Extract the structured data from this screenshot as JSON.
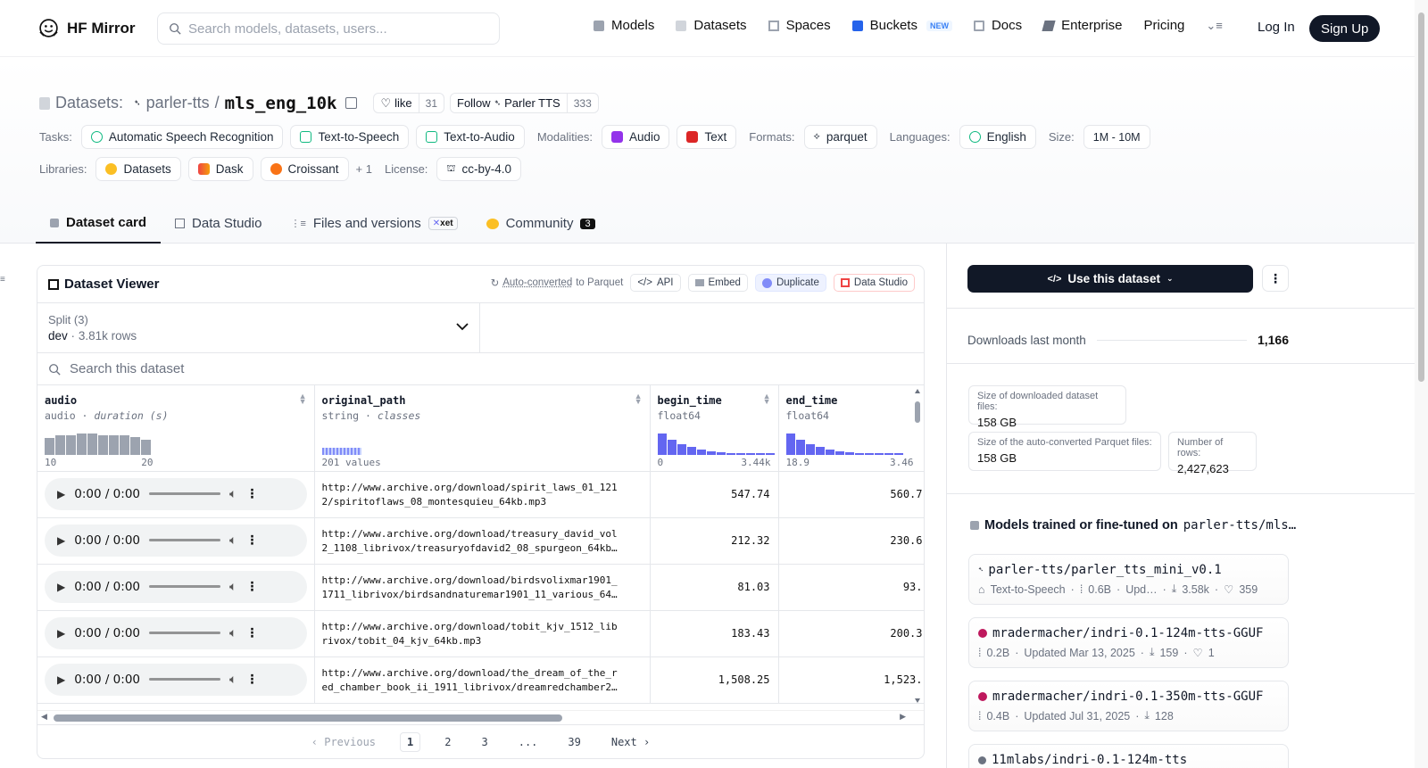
{
  "nav": {
    "brand": "HF Mirror",
    "search_placeholder": "Search models, datasets, users...",
    "links": [
      "Models",
      "Datasets",
      "Spaces",
      "Buckets",
      "Docs",
      "Enterprise",
      "Pricing"
    ],
    "new_badge": "NEW",
    "login": "Log In",
    "signup": "Sign Up"
  },
  "header": {
    "section": "Datasets:",
    "owner": "parler-tts",
    "sep": "/",
    "name": "mls_eng_10k",
    "like_label": "like",
    "like_count": "31",
    "follow_label": "Follow",
    "follow_org": "Parler TTS",
    "follow_count": "333"
  },
  "tags": {
    "tasks_label": "Tasks:",
    "tasks": [
      "Automatic Speech Recognition",
      "Text-to-Speech",
      "Text-to-Audio"
    ],
    "modalities_label": "Modalities:",
    "modalities": [
      "Audio",
      "Text"
    ],
    "formats_label": "Formats:",
    "formats": [
      "parquet"
    ],
    "languages_label": "Languages:",
    "languages": [
      "English"
    ],
    "size_label": "Size:",
    "size": "1M - 10M",
    "libraries_label": "Libraries:",
    "libraries": [
      "Datasets",
      "Dask",
      "Croissant"
    ],
    "libraries_more": "+ 1",
    "license_label": "License:",
    "license": "cc-by-4.0"
  },
  "tabs": {
    "card": "Dataset card",
    "studio": "Data Studio",
    "files": "Files and versions",
    "xet": "xet",
    "community": "Community",
    "community_count": "3"
  },
  "viewer": {
    "title": "Dataset Viewer",
    "autoconv_link": "Auto-converted",
    "autoconv_rest": "to Parquet",
    "api": "API",
    "embed": "Embed",
    "duplicate": "Duplicate",
    "data_studio": "Data Studio",
    "split_label": "Split (3)",
    "split_value": "dev",
    "split_rows": "3.81k rows",
    "search_placeholder": "Search this dataset",
    "columns": [
      {
        "name": "audio",
        "type": "audio",
        "sub": "duration (s)",
        "min": "10",
        "max": "20"
      },
      {
        "name": "original_path",
        "type": "string",
        "sub": "classes",
        "min": "201 values",
        "max": ""
      },
      {
        "name": "begin_time",
        "type": "float64",
        "sub": "",
        "min": "0",
        "max": "3.44k"
      },
      {
        "name": "end_time",
        "type": "float64",
        "sub": "",
        "min": "18.9",
        "max": "3.46"
      }
    ],
    "player_time": "0:00 / 0:00",
    "rows": [
      {
        "path1": "http://www.archive.org/download/spirit_laws_01_121",
        "path2": "2/spiritoflaws_08_montesquieu_64kb.mp3",
        "begin": "547.74",
        "end": "560.7"
      },
      {
        "path1": "http://www.archive.org/download/treasury_david_vol",
        "path2": "2_1108_librivox/treasuryofdavid2_08_spurgeon_64kb…",
        "begin": "212.32",
        "end": "230.6"
      },
      {
        "path1": "http://www.archive.org/download/birdsvolixmar1901_",
        "path2": "1711_librivox/birdsandnaturemar1901_11_various_64…",
        "begin": "81.03",
        "end": "93."
      },
      {
        "path1": "http://www.archive.org/download/tobit_kjv_1512_lib",
        "path2": "rivox/tobit_04_kjv_64kb.mp3",
        "begin": "183.43",
        "end": "200.3"
      },
      {
        "path1": "http://www.archive.org/download/the_dream_of_the_r",
        "path2": "ed_chamber_book_ii_1911_librivox/dreamredchamber2…",
        "begin": "1,508.25",
        "end": "1,523."
      }
    ],
    "pager": {
      "prev": "Previous",
      "pages": [
        "1",
        "2",
        "3",
        "...",
        "39"
      ],
      "next": "Next"
    }
  },
  "sidebar": {
    "use_button": "Use this dataset",
    "downloads_label": "Downloads last month",
    "downloads_value": "1,166",
    "size_dl_label": "Size of downloaded dataset files:",
    "size_dl_value": "158 GB",
    "size_pq_label": "Size of the auto-converted Parquet files:",
    "size_pq_value": "158 GB",
    "rows_label": "Number of rows:",
    "rows_value": "2,427,623",
    "models_title": "Models trained or fine-tuned on",
    "models_target": "parler-tts/mls…",
    "models": [
      {
        "name": "parler-tts/parler_tts_mini_v0.1",
        "task": "Text-to-Speech",
        "size": "0.6B",
        "updated": "Upd…",
        "downloads": "3.58k",
        "likes": "359"
      },
      {
        "name": "mradermacher/indri-0.1-124m-tts-GGUF",
        "task": "",
        "size": "0.2B",
        "updated": "Updated Mar 13, 2025",
        "downloads": "159",
        "likes": "1"
      },
      {
        "name": "mradermacher/indri-0.1-350m-tts-GGUF",
        "task": "",
        "size": "0.4B",
        "updated": "Updated Jul 31, 2025",
        "downloads": "128",
        "likes": ""
      },
      {
        "name": "11mlabs/indri-0.1-124m-tts",
        "task": "",
        "size": "",
        "updated": "",
        "downloads": "",
        "likes": ""
      }
    ]
  },
  "colors": {
    "accent": "#6366f1",
    "dark": "#111827",
    "histogram": "#6366f1",
    "audio_hist": "#9ca3af"
  }
}
